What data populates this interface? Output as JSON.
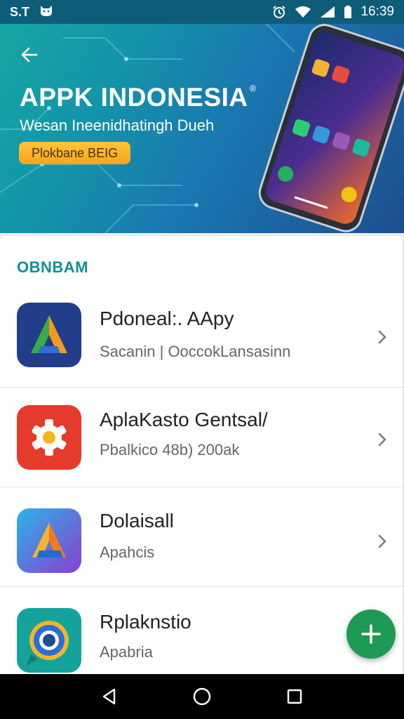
{
  "status_bar": {
    "carrier": "S.T",
    "time": "16:39"
  },
  "banner": {
    "title": "APPK INDONESIA",
    "trademark": "®",
    "subtitle": "Wesan Ineenidhatingh Dueh",
    "badge": "Plokbane BEIG"
  },
  "section": {
    "title": "OBNBAM"
  },
  "apps": [
    {
      "name": "Pdoneal:. AApy",
      "subtitle": "Sacanin | OoccokLansasinn",
      "icon": "drive-like-a-icon"
    },
    {
      "name": "AplaKasto Gentsal/",
      "subtitle": "Pbalkico 48b) 200ak",
      "icon": "gear-icon"
    },
    {
      "name": "Dolaisall",
      "subtitle": "Apahcis",
      "icon": "triangle-a-icon"
    },
    {
      "name": "Rplaknstio",
      "subtitle": "Apabria",
      "icon": "ring-chat-icon"
    }
  ],
  "colors": {
    "status_bar": "#0e5d78",
    "section_title": "#0f8f9c",
    "badge": "#f5a51b",
    "fab": "#1f9a55"
  }
}
